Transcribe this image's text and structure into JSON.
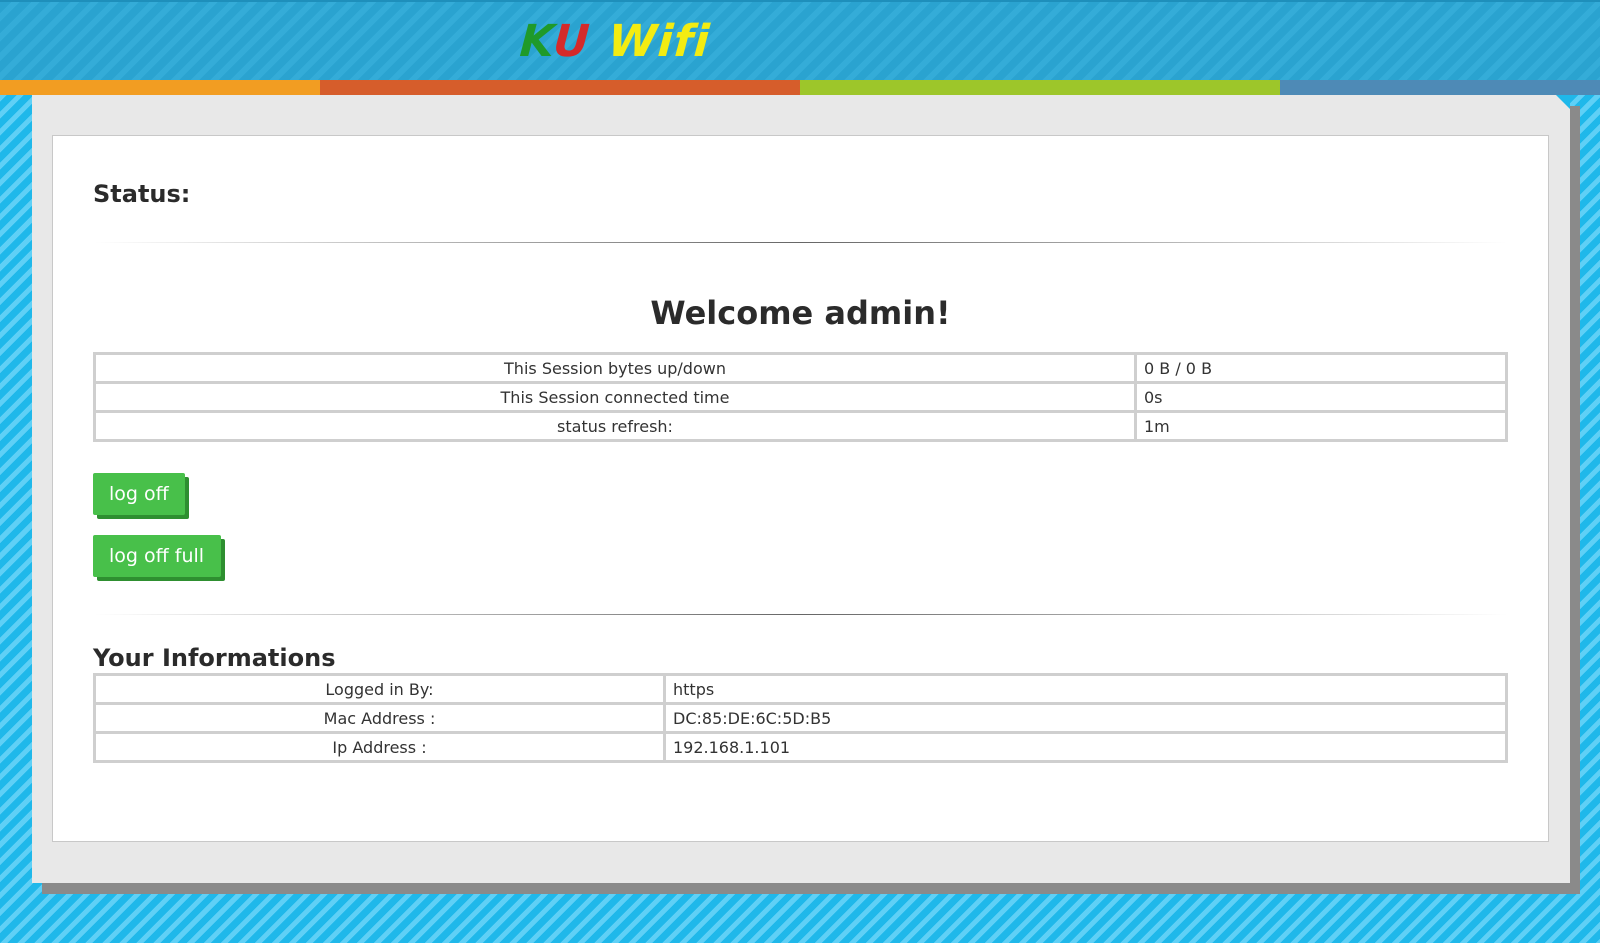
{
  "header": {
    "logo_part1": "K",
    "logo_part2": "U",
    "logo_part3": "Wifi",
    "colors": {
      "k": "#1f9a2a",
      "u": "#d52a2a",
      "wifi": "#f3ec12"
    }
  },
  "status": {
    "title": "Status:"
  },
  "welcome": "Welcome admin!",
  "session_table": [
    {
      "label": "This Session bytes up/down",
      "value": "0 B / 0 B"
    },
    {
      "label": "This Session connected time",
      "value": "0s"
    },
    {
      "label": "status refresh:",
      "value": "1m"
    }
  ],
  "buttons": {
    "log_off": "log off",
    "log_off_full": "log off full"
  },
  "user_info": {
    "title": "Your Informations",
    "rows": [
      {
        "label": "Logged in By:",
        "value": "https"
      },
      {
        "label": "Mac Address :",
        "value": "DC:85:DE:6C:5D:B5"
      },
      {
        "label": "Ip Address :",
        "value": "192.168.1.101"
      }
    ]
  }
}
